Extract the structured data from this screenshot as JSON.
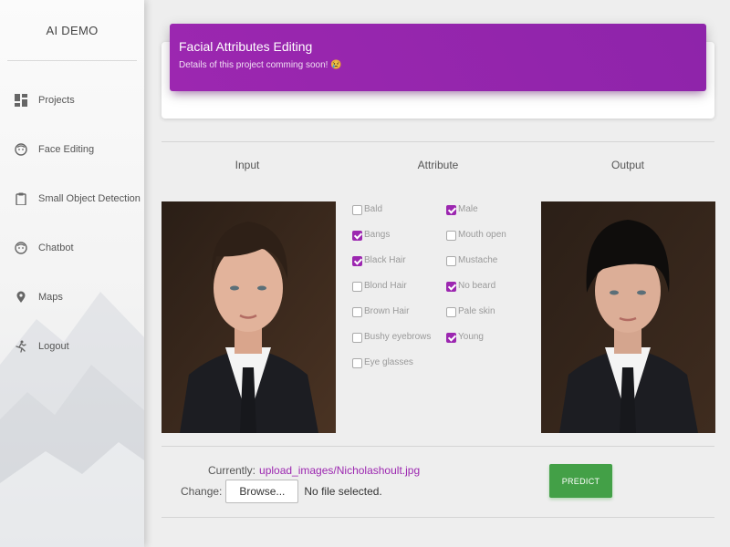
{
  "sidebar": {
    "brand": "AI DEMO",
    "items": [
      {
        "label": "Projects",
        "icon": "dashboard-icon"
      },
      {
        "label": "Face Editing",
        "icon": "face-icon"
      },
      {
        "label": "Small Object Detection",
        "icon": "clipboard-icon"
      },
      {
        "label": "Chatbot",
        "icon": "face-icon"
      },
      {
        "label": "Maps",
        "icon": "map-pin-icon"
      },
      {
        "label": "Logout",
        "icon": "run-icon"
      }
    ]
  },
  "header": {
    "title": "Facial Attributes Editing",
    "subtitle": "Details of this project comming soon!",
    "emoji": "😢"
  },
  "columns": {
    "input": "Input",
    "attribute": "Attribute",
    "output": "Output"
  },
  "attributes": {
    "left": [
      {
        "label": "Bald",
        "checked": false
      },
      {
        "label": "Bangs",
        "checked": true
      },
      {
        "label": "Black Hair",
        "checked": true
      },
      {
        "label": "Blond Hair",
        "checked": false
      },
      {
        "label": "Brown Hair",
        "checked": false
      },
      {
        "label": "Bushy eyebrows",
        "checked": false
      },
      {
        "label": "Eye glasses",
        "checked": false
      }
    ],
    "right": [
      {
        "label": "Male",
        "checked": true
      },
      {
        "label": "Mouth open",
        "checked": false
      },
      {
        "label": "Mustache",
        "checked": false
      },
      {
        "label": "No beard",
        "checked": true
      },
      {
        "label": "Pale skin",
        "checked": false
      },
      {
        "label": "Young",
        "checked": true
      }
    ]
  },
  "upload": {
    "currently_label": "Currently:",
    "current_file": "upload_images/Nicholashoult.jpg",
    "change_label": "Change:",
    "browse_label": "Browse...",
    "no_file": "No file selected."
  },
  "predict_label": "PREDICT",
  "colors": {
    "accent": "#9c27b0",
    "success": "#43a047"
  }
}
